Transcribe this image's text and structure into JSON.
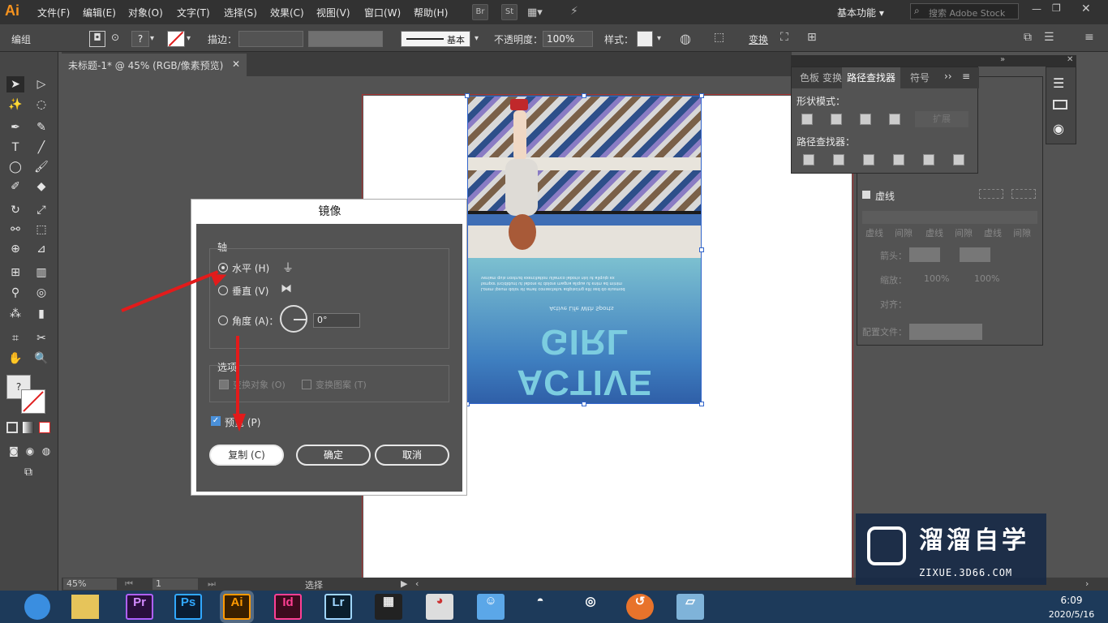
{
  "app": {
    "logo": "Ai",
    "menu": [
      "文件(F)",
      "编辑(E)",
      "对象(O)",
      "文字(T)",
      "选择(S)",
      "效果(C)",
      "视图(V)",
      "窗口(W)",
      "帮助(H)"
    ],
    "bridge_btn": "Br",
    "stock_btn": "St",
    "workspace": "基本功能",
    "search_placeholder": "搜索 Adobe Stock"
  },
  "control_bar": {
    "selection_label": "编组",
    "stroke_label": "描边：",
    "brush_label": "基本",
    "opacity_label": "不透明度：",
    "opacity_value": "100%",
    "style_label": "样式：",
    "transform_label": "变换"
  },
  "document": {
    "tab_title": "未标题-1* @ 45% (RGB/像素预览)",
    "zoom": "45%",
    "artboard_index": "1",
    "status_tool": "选择"
  },
  "poster": {
    "headline": "ACTIVE GIRL",
    "tagline": "Active Life With Sports",
    "copy_lines": [
      "Lorem ipsum dolor sit amet consectetur adipiscing elit sed do eiusmod",
      "tempor incididunt ut labore et dolore magna aliqua ut enim ad minim",
      "veniam quis nostrud exercitation ullamco laboris nisi ut aliquip ex"
    ]
  },
  "dialog": {
    "title": "镜像",
    "axis_group": "轴",
    "horizontal": "水平 (H)",
    "vertical": "垂直 (V)",
    "angle": "角度 (A)：",
    "angle_value": "0°",
    "options_group": "选项",
    "transform_objects": "变换对象 (O)",
    "transform_patterns": "变换图案 (T)",
    "preview": "预览 (P)",
    "copy_btn": "复制 (C)",
    "ok_btn": "确定",
    "cancel_btn": "取消"
  },
  "pathfinder": {
    "tab_color": "色板",
    "tab_transform": "变换",
    "tab_pathfinder": "路径查找器",
    "tab_symbols": "符号",
    "shape_modes": "形状模式：",
    "expand": "扩展",
    "pathfinders": "路径查找器："
  },
  "stroke_panel": {
    "dashed": "虚线",
    "dash_labels": [
      "虚线",
      "间隙",
      "虚线",
      "间隙",
      "虚线",
      "间隙"
    ],
    "arrows": "箭头：",
    "scale": "缩放：",
    "scale_a": "100%",
    "scale_b": "100%",
    "align": "对齐：",
    "profile": "配置文件："
  },
  "taskbar": {
    "apps": [
      "Pr",
      "Ps",
      "Ai",
      "Id",
      "Lr"
    ],
    "time": "6:09",
    "date": "2020/5/16"
  },
  "watermark": {
    "title": "溜溜自学",
    "subtitle": "ZIXUE.3D66.COM"
  }
}
